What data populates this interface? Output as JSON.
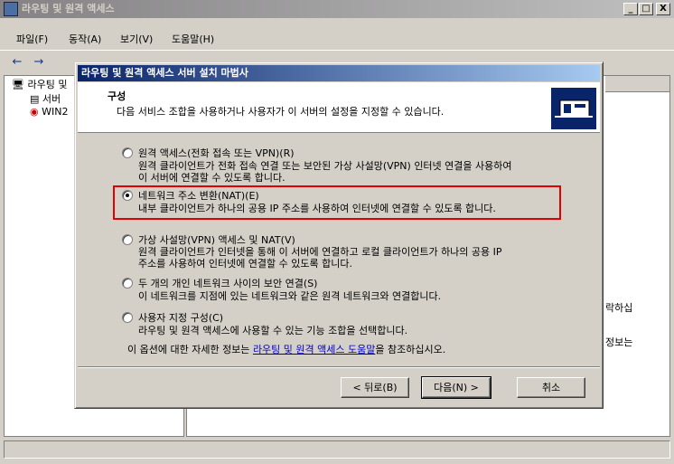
{
  "main_window": {
    "title": "라우팅 및 원격 액세스",
    "buttons": {
      "minimize": "_",
      "maximize": "□",
      "close": "X"
    },
    "menu": [
      "파일(F)",
      "동작(A)",
      "보기(V)",
      "도움말(H)"
    ],
    "tree": {
      "root": "라우팅 및",
      "child1": "서버",
      "child2": "WIN2"
    },
    "right_fragments": [
      "락하십",
      "정보는"
    ]
  },
  "wizard": {
    "title": "라우팅 및 원격 액세스 서버 설치 마법사",
    "header_title": "구성",
    "header_subtitle": "다음 서비스 조합을 사용하거나 사용자가 이 서버의 설정을 지정할 수 있습니다.",
    "options": [
      {
        "label": "원격 액세스(전화 접속 또는 VPN)(R)",
        "desc1": "원격 클라이언트가 전화 접속 연결 또는 보안된 가상 사설망(VPN) 인터넷 연결을 사용하여",
        "desc2": "이 서버에 연결할 수 있도록 합니다.",
        "checked": false
      },
      {
        "label": "네트워크 주소 변환(NAT)(E)",
        "desc1": "내부 클라이언트가 하나의 공용 IP 주소를 사용하여 인터넷에 연결할 수 있도록 합니다.",
        "checked": true
      },
      {
        "label": "가상 사설망(VPN) 액세스 및 NAT(V)",
        "desc1": "원격 클라이언트가 인터넷을 통해 이 서버에 연결하고 로컬 클라이언트가 하나의 공용 IP",
        "desc2": "주소를 사용하여 인터넷에 연결할 수 있도록 합니다.",
        "checked": false
      },
      {
        "label": "두 개의 개인 네트워크 사이의 보안 연결(S)",
        "desc1": "이 네트워크를 지점에 있는 네트워크와 같은 원격 네트워크와 연결합니다.",
        "checked": false
      },
      {
        "label": "사용자 지정 구성(C)",
        "desc1": "라우팅 및 원격 액세스에 사용할 수 있는 기능 조합을 선택합니다.",
        "checked": false
      }
    ],
    "help_prefix": "이 옵션에 대한 자세한 정보는 ",
    "help_link": "라우팅 및 원격 액세스 도움말",
    "help_suffix": "을 참조하십시오.",
    "buttons": {
      "back": "< 뒤로(B)",
      "next": "다음(N) >",
      "cancel": "취소"
    }
  }
}
